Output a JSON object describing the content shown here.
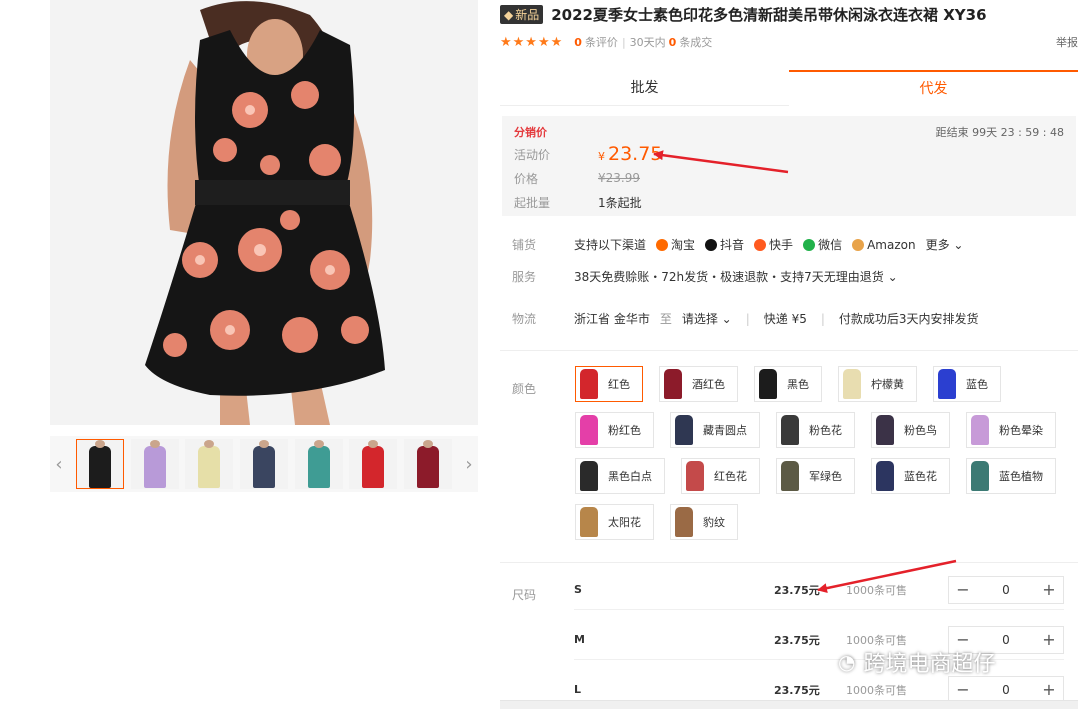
{
  "product": {
    "badge": "新品",
    "title": "2022夏季女士素色印花多色清新甜美吊带休闲泳衣连衣裙 XY36"
  },
  "rating": {
    "stars": "★★★★★",
    "reviews_count": "0",
    "reviews_label": "条评价",
    "sep": "|",
    "days_label": "30天内",
    "deals_count": "0",
    "deals_label": "条成交",
    "report": "举报"
  },
  "tabs": [
    {
      "label": "批发",
      "active": false
    },
    {
      "label": "代发",
      "active": true
    }
  ],
  "price_box": {
    "header": "分销价",
    "countdown": "距结束  99天 23 : 59 : 48",
    "activity_label": "活动价",
    "activity_currency": "¥",
    "activity_price": "23.75",
    "price_label": "价格",
    "original_price": "¥23.99",
    "moq_label": "起批量",
    "moq_value": "1条起批"
  },
  "services": {
    "supply_label": "铺货",
    "supply_prefix": "支持以下渠道",
    "channels": [
      {
        "name": "淘宝",
        "icon": "taobao-icon",
        "color": "#ff6a00"
      },
      {
        "name": "抖音",
        "icon": "douyin-icon",
        "color": "#111111"
      },
      {
        "name": "快手",
        "icon": "kuaishou-icon",
        "color": "#ff5a1f"
      },
      {
        "name": "微信",
        "icon": "wechat-icon",
        "color": "#21b14a"
      },
      {
        "name": "Amazon",
        "icon": "amazon-icon",
        "color": "#e8a34a"
      }
    ],
    "more": "更多 ⌄",
    "service_label": "服务",
    "service_value": "38天免费赊账・72h发货・极速退款・支持7天无理由退货 ⌄",
    "logistics_label": "物流",
    "from": "浙江省 金华市",
    "to_label": "至",
    "to_select": "请选择 ⌄",
    "express": "快递  ¥5",
    "ship_note": "付款成功后3天内安排发货"
  },
  "colors": {
    "label": "颜色",
    "options": [
      {
        "name": "红色",
        "swatch": "#d3262c",
        "active": true
      },
      {
        "name": "酒红色",
        "swatch": "#8c1b2a",
        "active": false
      },
      {
        "name": "黑色",
        "swatch": "#1c1c1c",
        "active": false
      },
      {
        "name": "柠檬黄",
        "swatch": "#e8ddb0",
        "active": false
      },
      {
        "name": "蓝色",
        "swatch": "#2b3fd0",
        "active": false
      },
      {
        "name": "粉红色",
        "swatch": "#e43fa8",
        "active": false
      },
      {
        "name": "藏青圆点",
        "swatch": "#2f3752",
        "active": false
      },
      {
        "name": "粉色花",
        "swatch": "#3a3a3a",
        "active": false
      },
      {
        "name": "粉色鸟",
        "swatch": "#3b3247",
        "active": false
      },
      {
        "name": "粉色晕染",
        "swatch": "#c79ad8",
        "active": false
      },
      {
        "name": "黑色白点",
        "swatch": "#2a2a2a",
        "active": false
      },
      {
        "name": "红色花",
        "swatch": "#c44a4a",
        "active": false
      },
      {
        "name": "军绿色",
        "swatch": "#5c5a45",
        "active": false
      },
      {
        "name": "蓝色花",
        "swatch": "#2c3560",
        "active": false
      },
      {
        "name": "蓝色植物",
        "swatch": "#3c7a74",
        "active": false
      },
      {
        "name": "太阳花",
        "swatch": "#b7864a",
        "active": false
      },
      {
        "name": "豹纹",
        "swatch": "#9a6a45",
        "active": false
      }
    ]
  },
  "sizes": {
    "label": "尺码",
    "rows": [
      {
        "size": "S",
        "price": "23.75元",
        "stock": "1000条可售",
        "qty": "0"
      },
      {
        "size": "M",
        "price": "23.75元",
        "stock": "1000条可售",
        "qty": "0"
      },
      {
        "size": "L",
        "price": "23.75元",
        "stock": "1000条可售",
        "qty": "0"
      }
    ],
    "minus": "−",
    "plus": "+"
  },
  "thumbnails": [
    {
      "color": "#1c1c1c",
      "active": true
    },
    {
      "color": "#b89ad8",
      "active": false
    },
    {
      "color": "#e6dfa8",
      "active": false
    },
    {
      "color": "#3a4560",
      "active": false
    },
    {
      "color": "#3f9c94",
      "active": false
    },
    {
      "color": "#d3262c",
      "active": false
    },
    {
      "color": "#8c1b2a",
      "active": false
    }
  ],
  "gallery": {
    "prev": "‹",
    "next": "›"
  },
  "watermark": "跨境电商超仔",
  "accent": "#ff5a00"
}
